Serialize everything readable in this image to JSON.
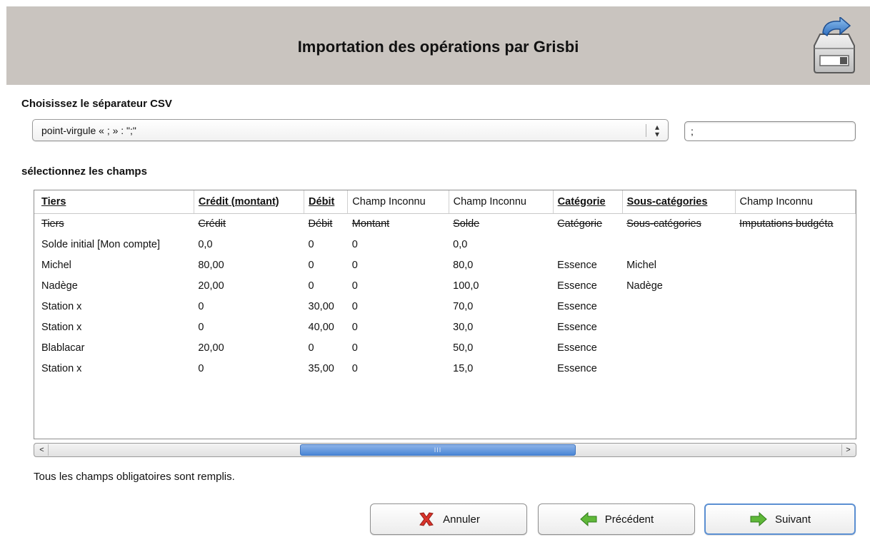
{
  "header": {
    "title": "Importation des opérations par Grisbi",
    "icon": "drive-import-icon"
  },
  "separator": {
    "label": "Choisissez le séparateur CSV",
    "selected": "point-virgule « ; » : \";\"",
    "custom_value": ";"
  },
  "fields": {
    "label": "sélectionnez les champs",
    "columns": [
      {
        "label": "Tiers",
        "selected": true
      },
      {
        "label": "Crédit (montant)",
        "selected": true
      },
      {
        "label": "Débit",
        "selected": true
      },
      {
        "label": "Champ Inconnu",
        "selected": false
      },
      {
        "label": "Champ Inconnu",
        "selected": false
      },
      {
        "label": "Catégorie",
        "selected": true
      },
      {
        "label": "Sous-catégories",
        "selected": true
      },
      {
        "label": "Champ Inconnu",
        "selected": false
      }
    ],
    "header_row": [
      "Tiers",
      "Crédit",
      "Débit",
      "Montant",
      "Solde",
      "Catégorie",
      "Sous-catégories",
      "Imputations budgéta"
    ],
    "rows": [
      [
        "Solde initial [Mon compte]",
        "0,0",
        "0",
        "0",
        "0,0",
        "",
        "",
        ""
      ],
      [
        "Michel",
        "80,00",
        "0",
        "0",
        "80,0",
        "Essence",
        "Michel",
        ""
      ],
      [
        "Nadège",
        "20,00",
        "0",
        "0",
        "100,0",
        "Essence",
        "Nadège",
        ""
      ],
      [
        "Station x",
        "0",
        "30,00",
        "0",
        "70,0",
        "Essence",
        "",
        ""
      ],
      [
        "Station x",
        "0",
        "40,00",
        "0",
        "30,0",
        "Essence",
        "",
        ""
      ],
      [
        "Blablacar",
        "20,00",
        "0",
        "0",
        "50,0",
        "Essence",
        "",
        ""
      ],
      [
        "Station x",
        "0",
        "35,00",
        "0",
        "15,0",
        "Essence",
        "",
        ""
      ]
    ]
  },
  "scrollbar": {
    "left_arrow": "<",
    "right_arrow": ">",
    "grip": "III"
  },
  "status": "Tous les champs obligatoires sont remplis.",
  "buttons": {
    "cancel": {
      "label": "Annuler",
      "icon": "cancel-x-icon"
    },
    "previous": {
      "label": "Précédent",
      "icon": "arrow-left-icon"
    },
    "next": {
      "label": "Suivant",
      "icon": "arrow-right-icon"
    }
  },
  "colors": {
    "header_bg": "#c9c4bf",
    "scroll_thumb": "#4a86d6",
    "arrow_green": "#5fb839",
    "cancel_red": "#d9342b"
  }
}
